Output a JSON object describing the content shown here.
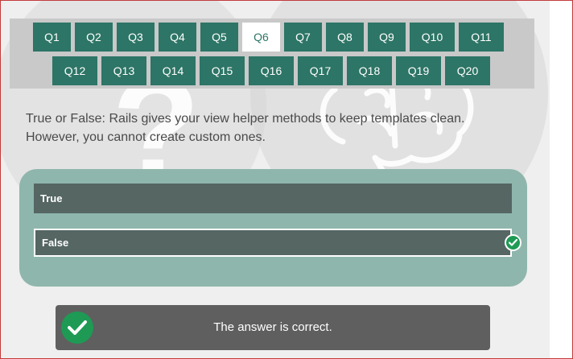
{
  "questions": [
    "Q1",
    "Q2",
    "Q3",
    "Q4",
    "Q5",
    "Q6",
    "Q7",
    "Q8",
    "Q9",
    "Q10",
    "Q11",
    "Q12",
    "Q13",
    "Q14",
    "Q15",
    "Q16",
    "Q17",
    "Q18",
    "Q19",
    "Q20"
  ],
  "active_question": "Q6",
  "question": {
    "line1": "True or False: Rails gives your view helper methods to keep templates clean.",
    "line2": "However, you cannot create custom ones."
  },
  "options": {
    "true_label": "True",
    "false_label": "False",
    "selected": "False"
  },
  "result": {
    "text": "The answer is correct."
  },
  "colors": {
    "accent": "#2d7566",
    "answers_bg": "#8fb6ac",
    "option_bg": "#556663",
    "success": "#1e9a55",
    "result_bg": "#5f5f5f"
  },
  "icons": {
    "selected_mark": "check-circle-icon",
    "result_mark": "check-circle-icon",
    "background_left": "question-mark-bubble",
    "background_right": "brain-bubble"
  }
}
